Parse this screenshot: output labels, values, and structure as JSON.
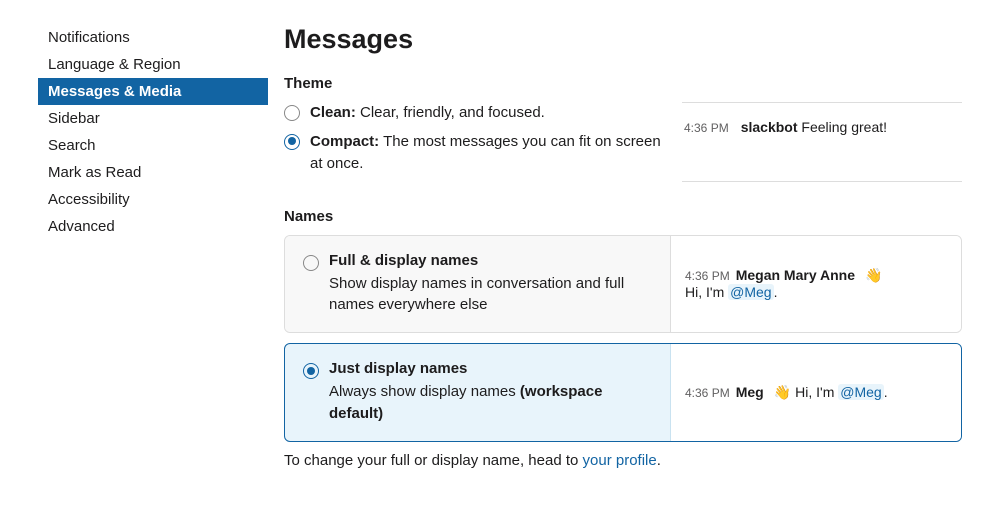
{
  "sidebar": {
    "items": [
      {
        "label": "Notifications"
      },
      {
        "label": "Language & Region"
      },
      {
        "label": "Messages & Media"
      },
      {
        "label": "Sidebar"
      },
      {
        "label": "Search"
      },
      {
        "label": "Mark as Read"
      },
      {
        "label": "Accessibility"
      },
      {
        "label": "Advanced"
      }
    ],
    "active_index": 2
  },
  "page": {
    "title": "Messages"
  },
  "theme": {
    "section_title": "Theme",
    "options": [
      {
        "title": "Clean:",
        "desc": "Clear, friendly, and focused."
      },
      {
        "title": "Compact:",
        "desc": "The most messages you can fit on screen at once."
      }
    ],
    "selected_index": 1,
    "preview": {
      "time": "4:36 PM",
      "sender": "slackbot",
      "text": "Feeling great!"
    }
  },
  "names": {
    "section_title": "Names",
    "options": [
      {
        "title": "Full & display names",
        "desc": "Show display names in conversation and full names everywhere else",
        "preview": {
          "time": "4:36 PM",
          "name": "Megan Mary Anne",
          "wave": "👋",
          "text_pre": "Hi, I'm ",
          "mention": "@Meg",
          "text_post": "."
        }
      },
      {
        "title": "Just display names",
        "desc_pre": "Always show display names ",
        "desc_bold": "(workspace default)",
        "preview": {
          "time": "4:36 PM",
          "name": "Meg",
          "wave": "👋",
          "text_pre": "Hi, I'm ",
          "mention": "@Meg",
          "text_post": "."
        }
      }
    ],
    "selected_index": 1
  },
  "footnote": {
    "text_pre": "To change your full or display name, head to ",
    "link": "your profile",
    "text_post": "."
  }
}
